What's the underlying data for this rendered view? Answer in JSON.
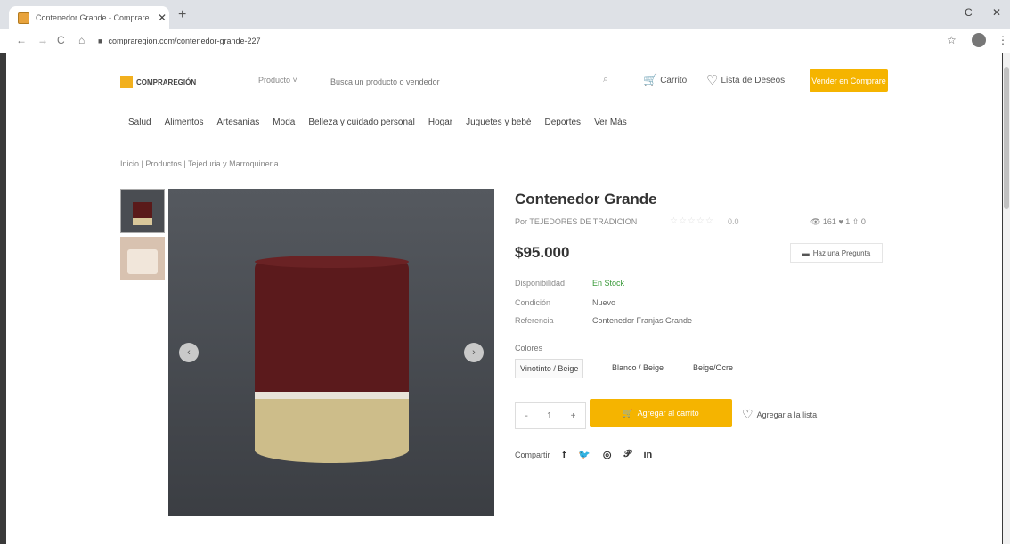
{
  "browser": {
    "tab_title": "Contenedor Grande - Comprare",
    "tab_close": "✕",
    "new_tab": "+",
    "url": "compraregion.com/contenedor-grande-227",
    "controls": {
      "back": "←",
      "forward": "→",
      "reload": "C",
      "home": "⌂",
      "bookmark": "☆",
      "win_restore": "C",
      "win_close": "✕",
      "menu": "⋮"
    }
  },
  "header": {
    "logo_text": "COMPRAREGIÓN",
    "category_select": "Producto ˅",
    "search_placeholder": "Busca un producto o vendedor",
    "cart_label": "Carrito",
    "wishlist_label": "Lista de Deseos",
    "sell_button": "Vender en Comprare"
  },
  "menu": [
    "Salud",
    "Alimentos",
    "Artesanías",
    "Moda",
    "Belleza y cuidado personal",
    "Hogar",
    "Juguetes y bebé",
    "Deportes",
    "Ver Más"
  ],
  "breadcrumb": "Inicio | Productos | Tejeduria y Marroquineria",
  "product": {
    "title": "Contenedor Grande",
    "seller": "Por TEJEDORES DE TRADICION",
    "stars": "☆☆☆☆☆",
    "rating": "0.0",
    "stats": "👁 161   ♥ 1   ⇧ 0",
    "price": "$95.000",
    "ask_button": "Haz una Pregunta",
    "availability_label": "Disponibilidad",
    "availability_value": "En Stock",
    "condition_label": "Condición",
    "condition_value": "Nuevo",
    "reference_label": "Referencia",
    "reference_value": "Contenedor Franjas Grande",
    "colors_label": "Colores",
    "colors": [
      "Vinotinto / Beige",
      "Blanco / Beige",
      "Beige/Ocre"
    ],
    "qty_minus": "-",
    "qty_value": "1",
    "qty_plus": "+",
    "add_to_cart": "Agregar al carrito",
    "add_to_list": "Agregar a la lista",
    "share_label": "Compartir",
    "share_icons": [
      "f",
      "🐦",
      "◎",
      "𝒫",
      "in"
    ]
  },
  "carousel": {
    "prev": "‹",
    "next": "›"
  },
  "colors": {
    "accent": "#f5b400",
    "in_stock": "#3a9a3a",
    "basket_top": "#5b1a1c",
    "basket_bottom": "#cdbd8a"
  }
}
